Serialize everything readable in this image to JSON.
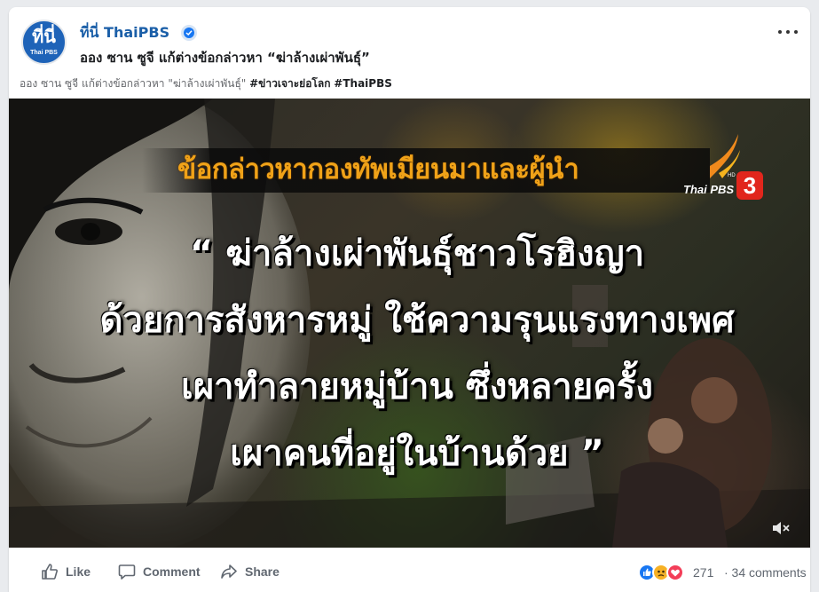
{
  "post": {
    "page_name": "ที่นี่ ThaiPBS",
    "avatar_text": "ที่นี่",
    "avatar_subtext": "Thai PBS",
    "title": "ออง ซาน ซูจี แก้ต่างข้อกล่าวหา “ฆ่าล้างเผ่าพันธุ์”",
    "caption_text": "ออง ซาน ซูจี แก้ต่างข้อกล่าวหา \"ฆ่าล้างเผ่าพันธุ์\" ",
    "hashtags": [
      "#ข่าวเจาะย่อโลก",
      "#ThaiPBS"
    ]
  },
  "media": {
    "headline": "ข้อกล่าวหากองทัพเมียนมาและผู้นำ",
    "channel_name": "Thai PBS",
    "channel_hd": "HD",
    "channel_number": "3",
    "quote_lines": [
      "“ ฆ่าล้างเผ่าพันธุ์ชาวโรฮิงญา",
      "ด้วยการสังหารหมู่  ใช้ความรุนแรงทางเพศ",
      "เผาทำลายหมู่บ้าน  ซึ่งหลายครั้ง",
      "เผาคนที่อยู่ในบ้านด้วย ”"
    ]
  },
  "actions": {
    "like": "Like",
    "comment": "Comment",
    "share": "Share"
  },
  "stats": {
    "reaction_count": "271",
    "comments": "· 34 comments"
  },
  "icons": {
    "verified": "verified-badge-icon",
    "more": "more-options-icon",
    "mute": "volume-muted-icon",
    "like": "thumbs-up-icon",
    "comment": "comment-bubble-icon",
    "share": "share-arrow-icon",
    "reactions": [
      "like-reaction-icon",
      "sad-reaction-icon",
      "love-reaction-icon"
    ]
  },
  "colors": {
    "page_name": "#1b5fa8",
    "headline": "#f0a218",
    "accent": "#1877f2",
    "channel_red": "#e1261c"
  }
}
